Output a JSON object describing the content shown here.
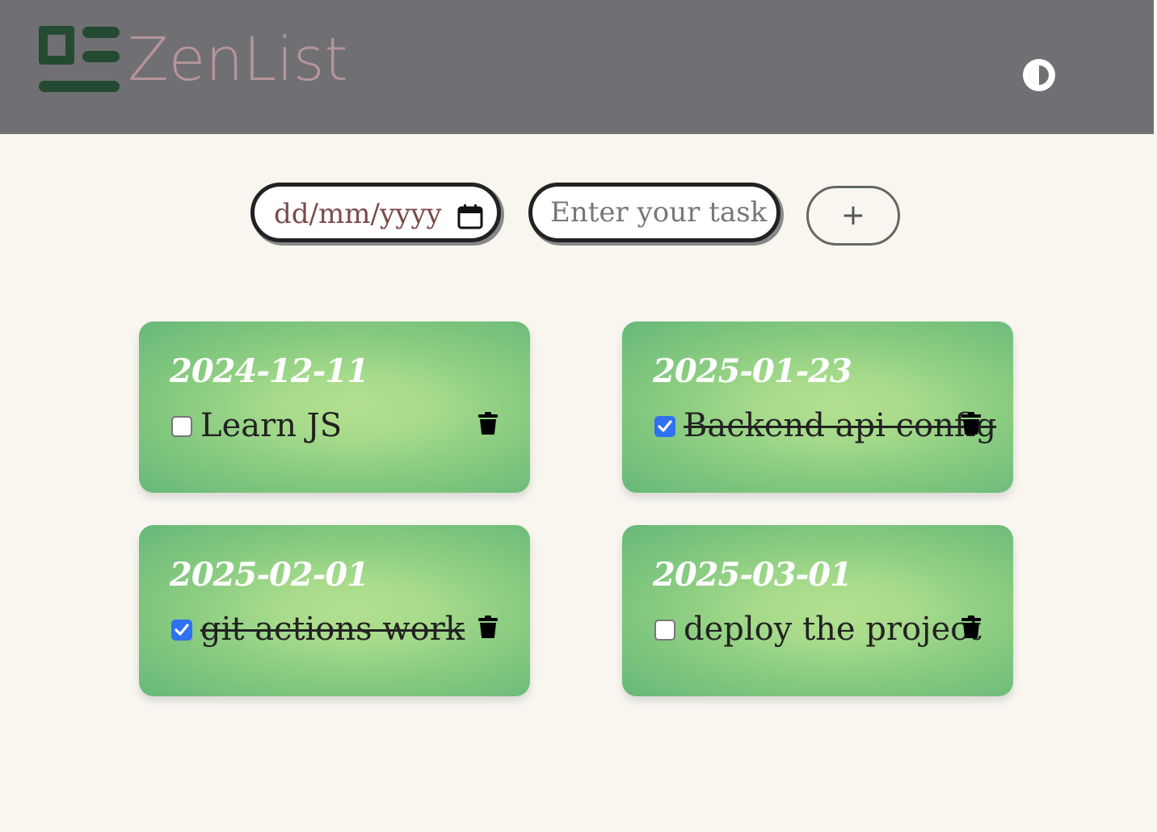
{
  "header": {
    "app_title": "ZenList",
    "logo_icon": "layout-list-icon",
    "theme_toggle_icon": "contrast-icon",
    "background_color": "#707074",
    "title_color": "#b5959a",
    "logo_color": "#244a32"
  },
  "form": {
    "date_placeholder": "dd/mm/yyyy",
    "calendar_icon": "calendar-icon",
    "task_placeholder": "Enter your task",
    "task_value": "",
    "add_label": "+"
  },
  "tasks": [
    {
      "date": "2024-12-11",
      "text": "Learn JS",
      "done": false
    },
    {
      "date": "2025-01-23",
      "text": "Backend api config",
      "done": true
    },
    {
      "date": "2025-02-01",
      "text": "git actions work",
      "done": true
    },
    {
      "date": "2025-03-01",
      "text": "deploy the project",
      "done": false
    }
  ],
  "colors": {
    "page_background": "#f8f6ef",
    "card_light": "#b3e090",
    "card_dark": "#66b878",
    "checkbox_checked": "#2f71f0"
  }
}
